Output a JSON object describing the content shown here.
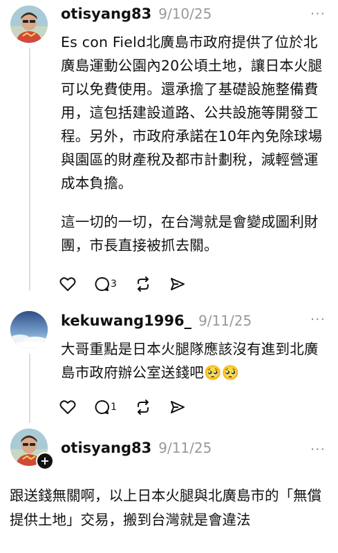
{
  "posts": [
    {
      "username": "otisyang83",
      "date": "9/10/25",
      "paragraphs": [
        "Es con Field北廣島市政府提供了位於北廣島運動公園內20公頃土地，讓日本火腿可以免費使用。還承擔了基礎設施整備費用，這包括建設道路、公共設施等開發工程。另外，市政府承諾在10年內免除球場與園區的財產稅及都市計劃稅，減輕營運成本負擔。",
        "這一切的一切，在台灣就是會變成圖利財團，市長直接被抓去關。"
      ],
      "reply_count": "3",
      "more_label": "···"
    },
    {
      "username": "kekuwang1996_",
      "date": "9/11/25",
      "paragraphs": [
        "大哥重點是日本火腿隊應該沒有進到北廣島市政府辦公室送錢吧🥺🥺"
      ],
      "reply_count": "1",
      "more_label": "···"
    },
    {
      "username": "otisyang83",
      "date": "9/11/25",
      "paragraphs": [
        "跟送錢無關啊，以上日本火腿與北廣島市的「無償提供土地」交易，搬到台灣就是會違法"
      ],
      "more_label": "···",
      "follow_badge": "+"
    }
  ],
  "icons": {
    "like": "heart-icon",
    "reply": "comment-icon",
    "repost": "repost-icon",
    "share": "send-icon",
    "more": "more-icon"
  }
}
